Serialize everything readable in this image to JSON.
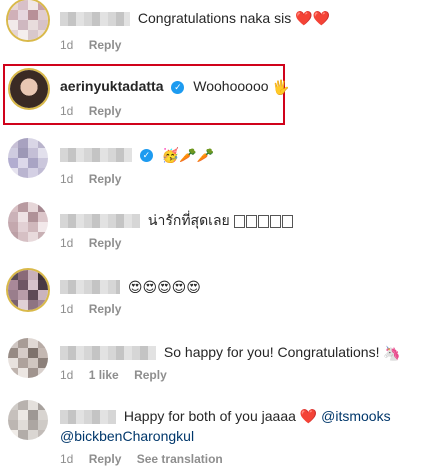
{
  "comments": [
    {
      "text": "Congratulations naka sis",
      "emoji": "❤️❤️",
      "time": "1d",
      "reply": "Reply"
    },
    {
      "username": "aerinyuktadatta",
      "verified": true,
      "text": "Woohooooo",
      "emoji": "🖐",
      "time": "1d",
      "reply": "Reply"
    },
    {
      "verified": true,
      "emoji": "🥳🥕🥕",
      "time": "1d",
      "reply": "Reply"
    },
    {
      "text": "น่ารักที่สุดเลย",
      "time": "1d",
      "reply": "Reply"
    },
    {
      "emoji": "😍😍😍😍😍",
      "time": "1d",
      "reply": "Reply"
    },
    {
      "text": "So happy for you! Congratulations!",
      "emoji": "🦄",
      "time": "1d",
      "likes": "1 like",
      "reply": "Reply"
    },
    {
      "text": "Happy for both of you jaaaa",
      "emoji": "❤️",
      "mentions": [
        "@itsmooks",
        "@bickbenCharongkul"
      ],
      "time": "1d",
      "reply": "Reply",
      "see_translation": "See translation"
    }
  ],
  "colors": {
    "highlight_border": "#d0021b",
    "verified": "#1d9bf0",
    "mention": "#00376b",
    "meta": "#8e8e8e"
  }
}
